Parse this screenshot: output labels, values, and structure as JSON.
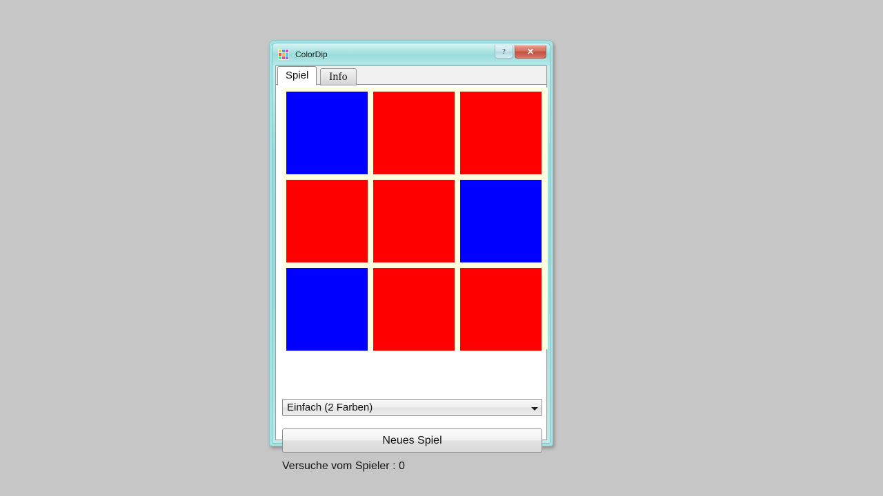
{
  "window": {
    "title": "ColorDip",
    "icon_name": "colordip-grid-icon",
    "icon_colors": [
      "#e8c84a",
      "#4aa3e8",
      "#c94ae8",
      "#e85a4a",
      "#f0c24a",
      "#4ad1e8",
      "#4ae87a",
      "#e84a9a",
      "#6a7ae8"
    ],
    "help_button_label": "?",
    "close_button_label": "✕"
  },
  "tabs": [
    {
      "label": "Spiel",
      "active": true
    },
    {
      "label": "Info",
      "active": false
    }
  ],
  "grid": {
    "rows": 3,
    "columns": 3,
    "colors": {
      "blue": "#0000ff",
      "red": "#fe0000"
    },
    "background": "#ffffe0",
    "cells": [
      [
        "blue",
        "red",
        "red"
      ],
      [
        "red",
        "red",
        "blue"
      ],
      [
        "blue",
        "red",
        "red"
      ]
    ]
  },
  "difficulty_select": {
    "value": "Einfach (2 Farben)",
    "arrow_icon": "chevron-down-icon"
  },
  "new_game_button": {
    "label": "Neues Spiel"
  },
  "status": {
    "text": "Versuche vom Spieler : 0"
  }
}
